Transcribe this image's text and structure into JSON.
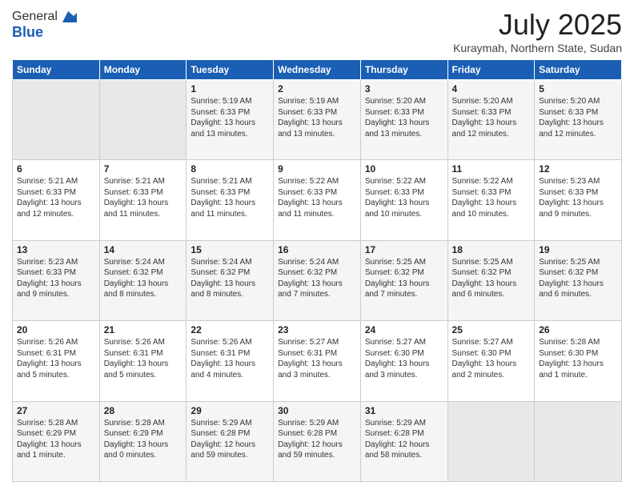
{
  "header": {
    "logo": {
      "line1": "General",
      "line2": "Blue"
    },
    "title": "July 2025",
    "subtitle": "Kuraymah, Northern State, Sudan"
  },
  "weekdays": [
    "Sunday",
    "Monday",
    "Tuesday",
    "Wednesday",
    "Thursday",
    "Friday",
    "Saturday"
  ],
  "weeks": [
    [
      {
        "day": "",
        "info": ""
      },
      {
        "day": "",
        "info": ""
      },
      {
        "day": "1",
        "info": "Sunrise: 5:19 AM\nSunset: 6:33 PM\nDaylight: 13 hours\nand 13 minutes."
      },
      {
        "day": "2",
        "info": "Sunrise: 5:19 AM\nSunset: 6:33 PM\nDaylight: 13 hours\nand 13 minutes."
      },
      {
        "day": "3",
        "info": "Sunrise: 5:20 AM\nSunset: 6:33 PM\nDaylight: 13 hours\nand 13 minutes."
      },
      {
        "day": "4",
        "info": "Sunrise: 5:20 AM\nSunset: 6:33 PM\nDaylight: 13 hours\nand 12 minutes."
      },
      {
        "day": "5",
        "info": "Sunrise: 5:20 AM\nSunset: 6:33 PM\nDaylight: 13 hours\nand 12 minutes."
      }
    ],
    [
      {
        "day": "6",
        "info": "Sunrise: 5:21 AM\nSunset: 6:33 PM\nDaylight: 13 hours\nand 12 minutes."
      },
      {
        "day": "7",
        "info": "Sunrise: 5:21 AM\nSunset: 6:33 PM\nDaylight: 13 hours\nand 11 minutes."
      },
      {
        "day": "8",
        "info": "Sunrise: 5:21 AM\nSunset: 6:33 PM\nDaylight: 13 hours\nand 11 minutes."
      },
      {
        "day": "9",
        "info": "Sunrise: 5:22 AM\nSunset: 6:33 PM\nDaylight: 13 hours\nand 11 minutes."
      },
      {
        "day": "10",
        "info": "Sunrise: 5:22 AM\nSunset: 6:33 PM\nDaylight: 13 hours\nand 10 minutes."
      },
      {
        "day": "11",
        "info": "Sunrise: 5:22 AM\nSunset: 6:33 PM\nDaylight: 13 hours\nand 10 minutes."
      },
      {
        "day": "12",
        "info": "Sunrise: 5:23 AM\nSunset: 6:33 PM\nDaylight: 13 hours\nand 9 minutes."
      }
    ],
    [
      {
        "day": "13",
        "info": "Sunrise: 5:23 AM\nSunset: 6:33 PM\nDaylight: 13 hours\nand 9 minutes."
      },
      {
        "day": "14",
        "info": "Sunrise: 5:24 AM\nSunset: 6:32 PM\nDaylight: 13 hours\nand 8 minutes."
      },
      {
        "day": "15",
        "info": "Sunrise: 5:24 AM\nSunset: 6:32 PM\nDaylight: 13 hours\nand 8 minutes."
      },
      {
        "day": "16",
        "info": "Sunrise: 5:24 AM\nSunset: 6:32 PM\nDaylight: 13 hours\nand 7 minutes."
      },
      {
        "day": "17",
        "info": "Sunrise: 5:25 AM\nSunset: 6:32 PM\nDaylight: 13 hours\nand 7 minutes."
      },
      {
        "day": "18",
        "info": "Sunrise: 5:25 AM\nSunset: 6:32 PM\nDaylight: 13 hours\nand 6 minutes."
      },
      {
        "day": "19",
        "info": "Sunrise: 5:25 AM\nSunset: 6:32 PM\nDaylight: 13 hours\nand 6 minutes."
      }
    ],
    [
      {
        "day": "20",
        "info": "Sunrise: 5:26 AM\nSunset: 6:31 PM\nDaylight: 13 hours\nand 5 minutes."
      },
      {
        "day": "21",
        "info": "Sunrise: 5:26 AM\nSunset: 6:31 PM\nDaylight: 13 hours\nand 5 minutes."
      },
      {
        "day": "22",
        "info": "Sunrise: 5:26 AM\nSunset: 6:31 PM\nDaylight: 13 hours\nand 4 minutes."
      },
      {
        "day": "23",
        "info": "Sunrise: 5:27 AM\nSunset: 6:31 PM\nDaylight: 13 hours\nand 3 minutes."
      },
      {
        "day": "24",
        "info": "Sunrise: 5:27 AM\nSunset: 6:30 PM\nDaylight: 13 hours\nand 3 minutes."
      },
      {
        "day": "25",
        "info": "Sunrise: 5:27 AM\nSunset: 6:30 PM\nDaylight: 13 hours\nand 2 minutes."
      },
      {
        "day": "26",
        "info": "Sunrise: 5:28 AM\nSunset: 6:30 PM\nDaylight: 13 hours\nand 1 minute."
      }
    ],
    [
      {
        "day": "27",
        "info": "Sunrise: 5:28 AM\nSunset: 6:29 PM\nDaylight: 13 hours\nand 1 minute."
      },
      {
        "day": "28",
        "info": "Sunrise: 5:28 AM\nSunset: 6:29 PM\nDaylight: 13 hours\nand 0 minutes."
      },
      {
        "day": "29",
        "info": "Sunrise: 5:29 AM\nSunset: 6:28 PM\nDaylight: 12 hours\nand 59 minutes."
      },
      {
        "day": "30",
        "info": "Sunrise: 5:29 AM\nSunset: 6:28 PM\nDaylight: 12 hours\nand 59 minutes."
      },
      {
        "day": "31",
        "info": "Sunrise: 5:29 AM\nSunset: 6:28 PM\nDaylight: 12 hours\nand 58 minutes."
      },
      {
        "day": "",
        "info": ""
      },
      {
        "day": "",
        "info": ""
      }
    ]
  ]
}
